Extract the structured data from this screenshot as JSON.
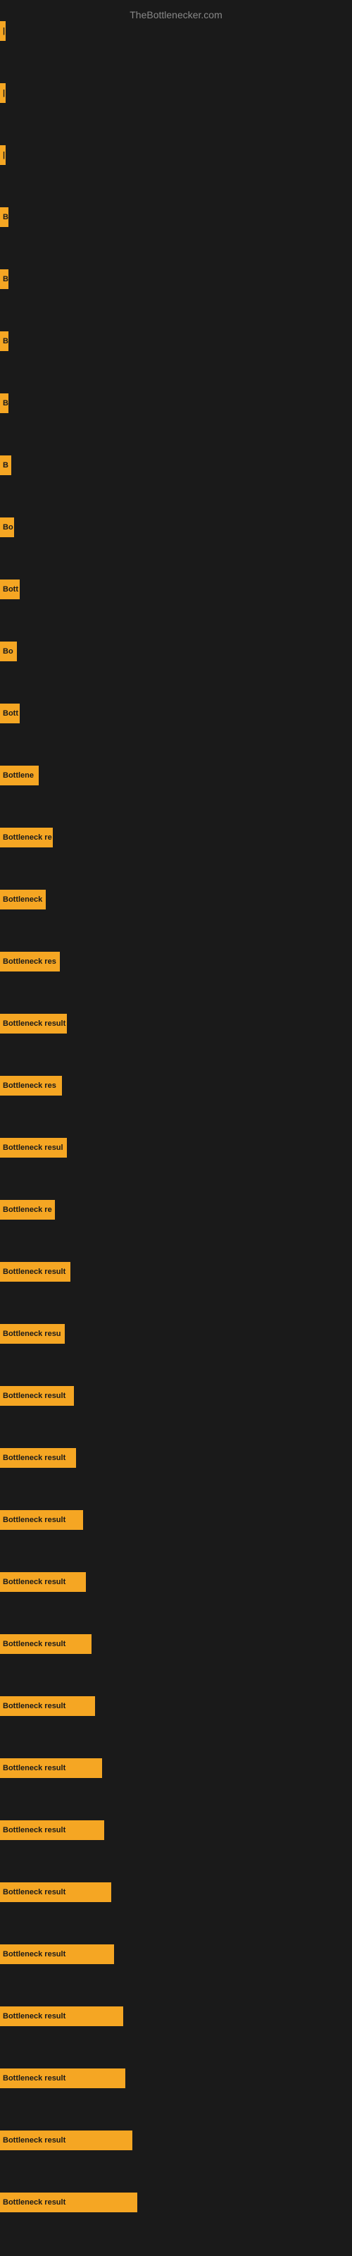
{
  "site": {
    "title": "TheBottlenecker.com"
  },
  "bars": [
    {
      "id": 1,
      "width": 8,
      "label": "|",
      "gap": 12
    },
    {
      "id": 2,
      "width": 8,
      "label": "|",
      "gap": 12
    },
    {
      "id": 3,
      "width": 8,
      "label": "|",
      "gap": 12
    },
    {
      "id": 4,
      "width": 12,
      "label": "B",
      "gap": 12
    },
    {
      "id": 5,
      "width": 12,
      "label": "B",
      "gap": 12
    },
    {
      "id": 6,
      "width": 12,
      "label": "B",
      "gap": 12
    },
    {
      "id": 7,
      "width": 12,
      "label": "B",
      "gap": 12
    },
    {
      "id": 8,
      "width": 16,
      "label": "B",
      "gap": 12
    },
    {
      "id": 9,
      "width": 20,
      "label": "Bo",
      "gap": 12
    },
    {
      "id": 10,
      "width": 28,
      "label": "Bott",
      "gap": 12
    },
    {
      "id": 11,
      "width": 24,
      "label": "Bo",
      "gap": 12
    },
    {
      "id": 12,
      "width": 28,
      "label": "Bott",
      "gap": 12
    },
    {
      "id": 13,
      "width": 55,
      "label": "Bottlene",
      "gap": 12
    },
    {
      "id": 14,
      "width": 75,
      "label": "Bottleneck re",
      "gap": 12
    },
    {
      "id": 15,
      "width": 65,
      "label": "Bottleneck",
      "gap": 12
    },
    {
      "id": 16,
      "width": 85,
      "label": "Bottleneck res",
      "gap": 12
    },
    {
      "id": 17,
      "width": 95,
      "label": "Bottleneck result",
      "gap": 12
    },
    {
      "id": 18,
      "width": 88,
      "label": "Bottleneck res",
      "gap": 12
    },
    {
      "id": 19,
      "width": 95,
      "label": "Bottleneck resul",
      "gap": 12
    },
    {
      "id": 20,
      "width": 78,
      "label": "Bottleneck re",
      "gap": 12
    },
    {
      "id": 21,
      "width": 100,
      "label": "Bottleneck result",
      "gap": 12
    },
    {
      "id": 22,
      "width": 92,
      "label": "Bottleneck resu",
      "gap": 12
    },
    {
      "id": 23,
      "width": 105,
      "label": "Bottleneck result",
      "gap": 12
    },
    {
      "id": 24,
      "width": 108,
      "label": "Bottleneck result",
      "gap": 12
    },
    {
      "id": 25,
      "width": 118,
      "label": "Bottleneck result",
      "gap": 12
    },
    {
      "id": 26,
      "width": 122,
      "label": "Bottleneck result",
      "gap": 12
    },
    {
      "id": 27,
      "width": 130,
      "label": "Bottleneck result",
      "gap": 12
    },
    {
      "id": 28,
      "width": 135,
      "label": "Bottleneck result",
      "gap": 12
    },
    {
      "id": 29,
      "width": 145,
      "label": "Bottleneck result",
      "gap": 12
    },
    {
      "id": 30,
      "width": 148,
      "label": "Bottleneck result",
      "gap": 12
    },
    {
      "id": 31,
      "width": 158,
      "label": "Bottleneck result",
      "gap": 12
    },
    {
      "id": 32,
      "width": 162,
      "label": "Bottleneck result",
      "gap": 12
    },
    {
      "id": 33,
      "width": 175,
      "label": "Bottleneck result",
      "gap": 12
    },
    {
      "id": 34,
      "width": 178,
      "label": "Bottleneck result",
      "gap": 12
    },
    {
      "id": 35,
      "width": 188,
      "label": "Bottleneck result",
      "gap": 12
    },
    {
      "id": 36,
      "width": 195,
      "label": "Bottleneck result",
      "gap": 0
    }
  ]
}
